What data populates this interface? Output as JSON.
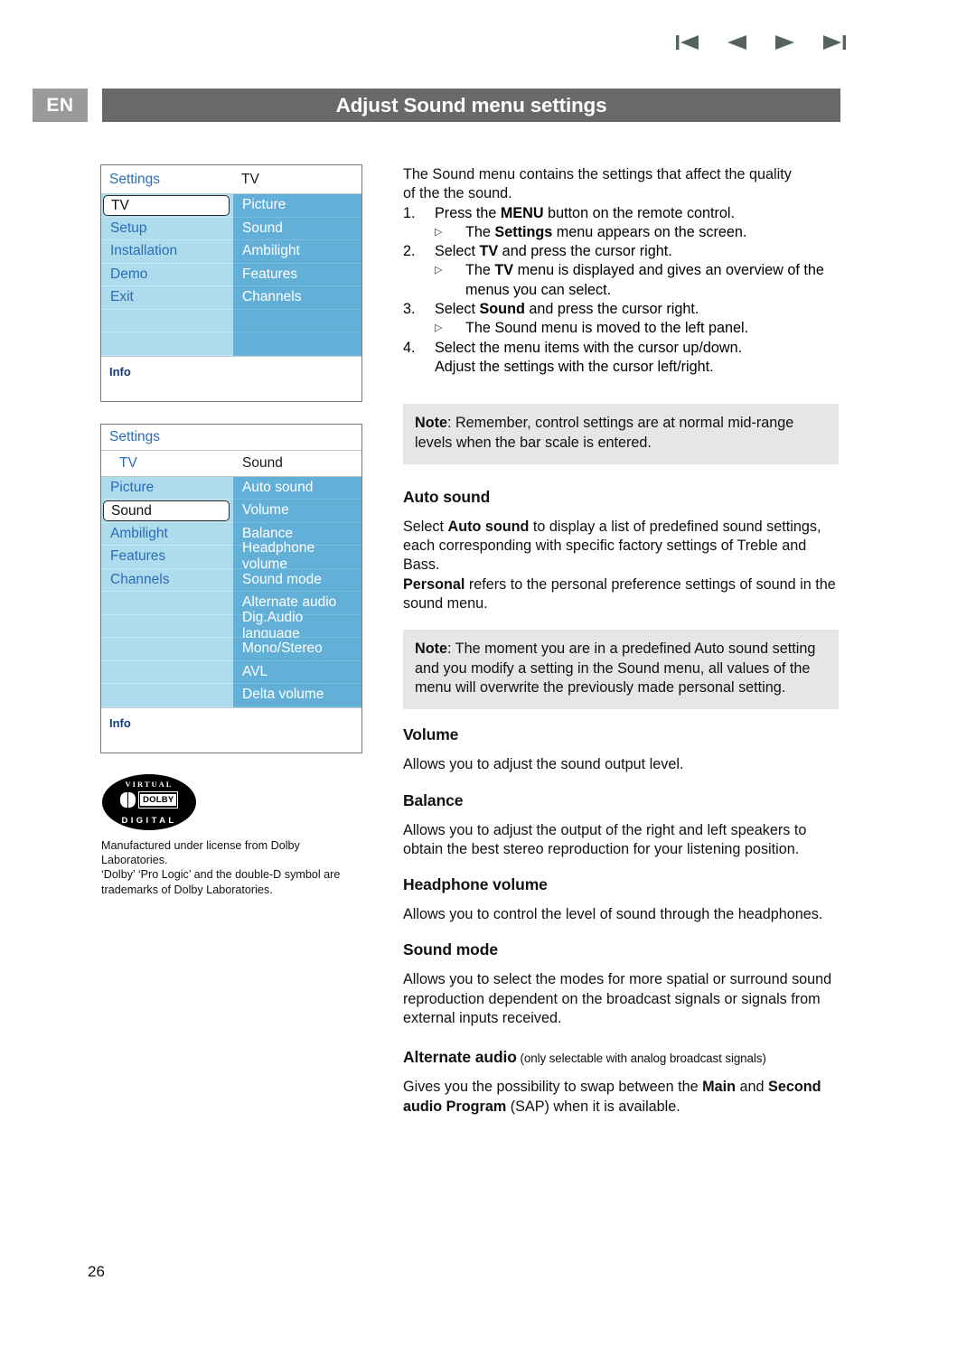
{
  "header": {
    "language": "EN",
    "title": "Adjust Sound menu settings",
    "nav": [
      "first-page-icon",
      "previous-page-icon",
      "next-page-icon",
      "last-page-icon"
    ]
  },
  "page_number": "26",
  "menu_panel_1": {
    "settings_label": "Settings",
    "header_right": "TV",
    "left_items": [
      "TV",
      "Setup",
      "Installation",
      "Demo",
      "Exit"
    ],
    "left_selected": "TV",
    "right_items": [
      "Picture",
      "Sound",
      "Ambilight",
      "Features",
      "Channels"
    ],
    "info_label": "Info"
  },
  "menu_panel_2": {
    "settings_label": "Settings",
    "breadcrumb": "TV",
    "header_right": "Sound",
    "left_items": [
      "Picture",
      "Sound",
      "Ambilight",
      "Features",
      "Channels"
    ],
    "left_selected": "Sound",
    "right_items": [
      "Auto sound",
      "Volume",
      "Balance",
      "Headphone volume",
      "Sound mode",
      "Alternate audio",
      "Dig.Audio language",
      "Mono/Stereo",
      "AVL",
      "Delta volume"
    ],
    "info_label": "Info"
  },
  "dolby": {
    "logo_top": "VIRTUAL",
    "logo_label": "DOLBY",
    "logo_bottom": "DIGITAL",
    "line1": "Manufactured under license from Dolby",
    "line2": "Laboratories.",
    "line3": "‘Dolby’ ‘Pro Logic’ and the double-D symbol are",
    "line4": "trademarks of Dolby Laboratories."
  },
  "content": {
    "intro_line1": "The Sound menu contains the settings that affect the quality",
    "intro_line2": "of the the sound.",
    "steps": [
      {
        "num": "1.",
        "text_pre": "Press the ",
        "text_bold": "MENU",
        "text_post": " button on the remote control.",
        "subs": [
          {
            "pre": "The ",
            "bold": "Settings",
            "post": " menu appears on the screen."
          }
        ]
      },
      {
        "num": "2.",
        "text_pre": "Select ",
        "text_bold": "TV",
        "text_post": " and press the cursor right.",
        "subs": [
          {
            "pre": "The ",
            "bold": "TV",
            "post": " menu is displayed and gives an overview of the"
          },
          {
            "cont": "menus you can select."
          }
        ]
      },
      {
        "num": "3.",
        "text_pre": "Select ",
        "text_bold": "Sound",
        "text_post": " and press the cursor right.",
        "subs": [
          {
            "pre": "The Sound menu is moved to the left panel.",
            "bold": "",
            "post": ""
          }
        ]
      },
      {
        "num": "4.",
        "text_pre": "Select the menu items with the cursor up/down.",
        "text_bold": "",
        "text_post": "",
        "subs": [
          {
            "cont2": "Adjust the settings with the cursor left/right."
          }
        ]
      }
    ],
    "note1_label": "Note",
    "note1_text": ": Remember, control settings are at normal mid-range levels when the bar scale is entered.",
    "sections": [
      {
        "heading": "Auto sound",
        "p1_pre": "Select ",
        "p1_bold": "Auto sound",
        "p1_post": " to display a list of predefined sound settings, each corresponding with specific factory settings of Treble and Bass.",
        "p2_bold": "Personal",
        "p2_post": " refers to the personal preference settings of sound in the sound menu."
      }
    ],
    "note2_label": "Note",
    "note2_text": ": The moment you are in a predefined Auto sound setting and you modify a setting in the Sound menu, all values of the menu will overwrite the previously made personal setting.",
    "volume_heading": "Volume",
    "volume_text": "Allows you to adjust the sound output level.",
    "balance_heading": "Balance",
    "balance_text": "Allows you to adjust the output of the right and left speakers to obtain the best stereo reproduction for your listening position.",
    "headphone_heading": "Headphone volume",
    "headphone_text": "Allows you to control the level of sound through the headphones.",
    "soundmode_heading": "Sound mode",
    "soundmode_text": "Allows you to select the modes for more spatial or surround sound reproduction dependent on the broadcast signals or signals from external inputs received.",
    "altaudio_heading": "Alternate audio",
    "altaudio_note": " (only selectable with analog broadcast signals)",
    "altaudio_pre": "Gives you the possibility to swap between the ",
    "altaudio_b1": "Main",
    "altaudio_mid": " and ",
    "altaudio_b2": "Second audio Program",
    "altaudio_post": " (SAP) when it is available."
  },
  "colors": {
    "title_bar": "#696969",
    "lang_box": "#9a9a9a",
    "menu_left": "#aedcec",
    "menu_right": "#62b0d8",
    "menu_blue_text": "#2b6cb8",
    "note_bg": "#e6e6e6",
    "nav_icon": "#55625f"
  }
}
